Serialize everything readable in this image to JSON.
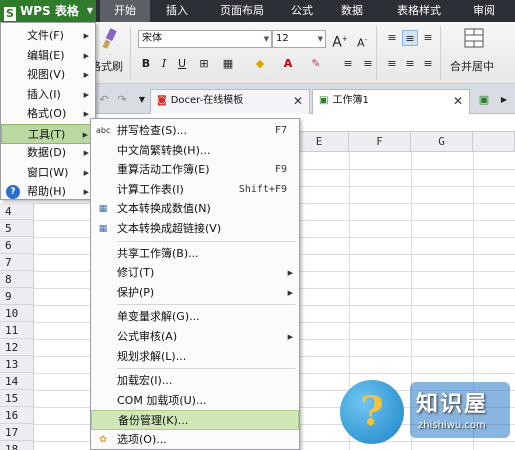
{
  "app": {
    "name": "WPS 表格",
    "logo_letter": "S"
  },
  "ribbon_tabs": [
    "开始",
    "插入",
    "页面布局",
    "公式",
    "数据",
    "表格样式",
    "审阅"
  ],
  "ribbon": {
    "format_painter": "格式刷",
    "font_name": "宋体",
    "font_size": "12",
    "merge_center": "合并居中",
    "bold": "B",
    "italic": "I",
    "underline": "U",
    "increase_font": "A",
    "decrease_font": "A"
  },
  "doc_tabs": [
    {
      "label": "Docer-在线模板"
    },
    {
      "label": "工作簿1"
    }
  ],
  "columns": [
    "E",
    "F",
    "G"
  ],
  "rows": [
    "4",
    "5",
    "6",
    "7",
    "8",
    "9",
    "10",
    "11",
    "12",
    "13",
    "14",
    "15",
    "16",
    "17",
    "18"
  ],
  "main_menu": [
    {
      "label": "文件(F)",
      "has_sub": true
    },
    {
      "label": "编辑(E)",
      "has_sub": true
    },
    {
      "label": "视图(V)",
      "has_sub": true
    },
    {
      "label": "插入(I)",
      "has_sub": true
    },
    {
      "label": "格式(O)",
      "has_sub": true
    },
    {
      "label": "工具(T)",
      "has_sub": true,
      "active": true
    },
    {
      "label": "数据(D)",
      "has_sub": true
    },
    {
      "label": "窗口(W)",
      "has_sub": true
    },
    {
      "label": "帮助(H)",
      "has_sub": true
    }
  ],
  "tools_menu": [
    {
      "label": "拼写检查(S)...",
      "shortcut": "F7",
      "icon": "spellcheck-icon",
      "glyph": "abc"
    },
    {
      "label": "中文简繁转换(H)...",
      "shortcut": "",
      "icon": "",
      "glyph": ""
    },
    {
      "label": "重算活动工作簿(E)",
      "shortcut": "F9",
      "icon": "",
      "glyph": ""
    },
    {
      "label": "计算工作表(I)",
      "shortcut": "Shift+F9",
      "icon": "",
      "glyph": ""
    },
    {
      "label": "文本转换成数值(N)",
      "shortcut": "",
      "icon": "text-to-number-icon",
      "glyph": "▦"
    },
    {
      "label": "文本转换成超链接(V)",
      "shortcut": "",
      "icon": "text-to-link-icon",
      "glyph": "▦"
    },
    {
      "separator": true
    },
    {
      "label": "共享工作簿(B)...",
      "shortcut": "",
      "icon": "",
      "glyph": ""
    },
    {
      "label": "修订(T)",
      "shortcut": "",
      "sub": true,
      "icon": "",
      "glyph": ""
    },
    {
      "label": "保护(P)",
      "shortcut": "",
      "sub": true,
      "icon": "",
      "glyph": ""
    },
    {
      "separator": true
    },
    {
      "label": "单变量求解(G)...",
      "shortcut": "",
      "icon": "",
      "glyph": ""
    },
    {
      "label": "公式审核(A)",
      "shortcut": "",
      "sub": true,
      "icon": "",
      "glyph": ""
    },
    {
      "label": "规划求解(L)...",
      "shortcut": "",
      "icon": "",
      "glyph": ""
    },
    {
      "separator": true
    },
    {
      "label": "加载宏(I)...",
      "shortcut": "",
      "icon": "",
      "glyph": ""
    },
    {
      "label": "COM 加载项(U)...",
      "shortcut": "",
      "icon": "",
      "glyph": ""
    },
    {
      "label": "备份管理(K)...",
      "shortcut": "",
      "icon": "",
      "glyph": "",
      "highlight": true
    },
    {
      "label": "选项(O)...",
      "shortcut": "",
      "icon": "gear-icon",
      "glyph": "✿"
    }
  ],
  "watermark": {
    "title": "知识屋",
    "url": "zhishiwu.com"
  },
  "colors": {
    "title_bg": "#2c2f36",
    "wps_green": "#2f7d2a",
    "menu_highlight": "#d0e8b8",
    "grid_header": "#eceef1"
  }
}
